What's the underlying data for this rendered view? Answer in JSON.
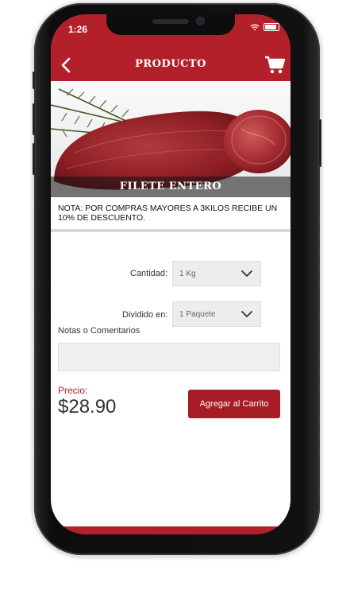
{
  "status_bar": {
    "time": "1:26"
  },
  "nav": {
    "title": "PRODUCTO"
  },
  "product": {
    "name": "FILETE ENTERO",
    "note": "NOTA: POR COMPRAS MAYORES A 3KILOS RECIBE UN 10% DE DESCUENTO."
  },
  "form": {
    "quantity_label": "Cantidad:",
    "quantity_value": "1 Kg",
    "divided_label": "Dividido en:",
    "divided_value": "1 Paquete",
    "notes_label": "Notas o Comentarios",
    "notes_value": ""
  },
  "price": {
    "label": "Precio:",
    "value": "$28.90"
  },
  "actions": {
    "add_to_cart": "Agregar al Carrito"
  },
  "colors": {
    "brand": "#b3202a",
    "button": "#a61c24",
    "field": "#ededed"
  },
  "icons": [
    "back-arrow-icon",
    "cart-icon",
    "wifi-icon",
    "battery-icon",
    "chevron-down-icon"
  ]
}
